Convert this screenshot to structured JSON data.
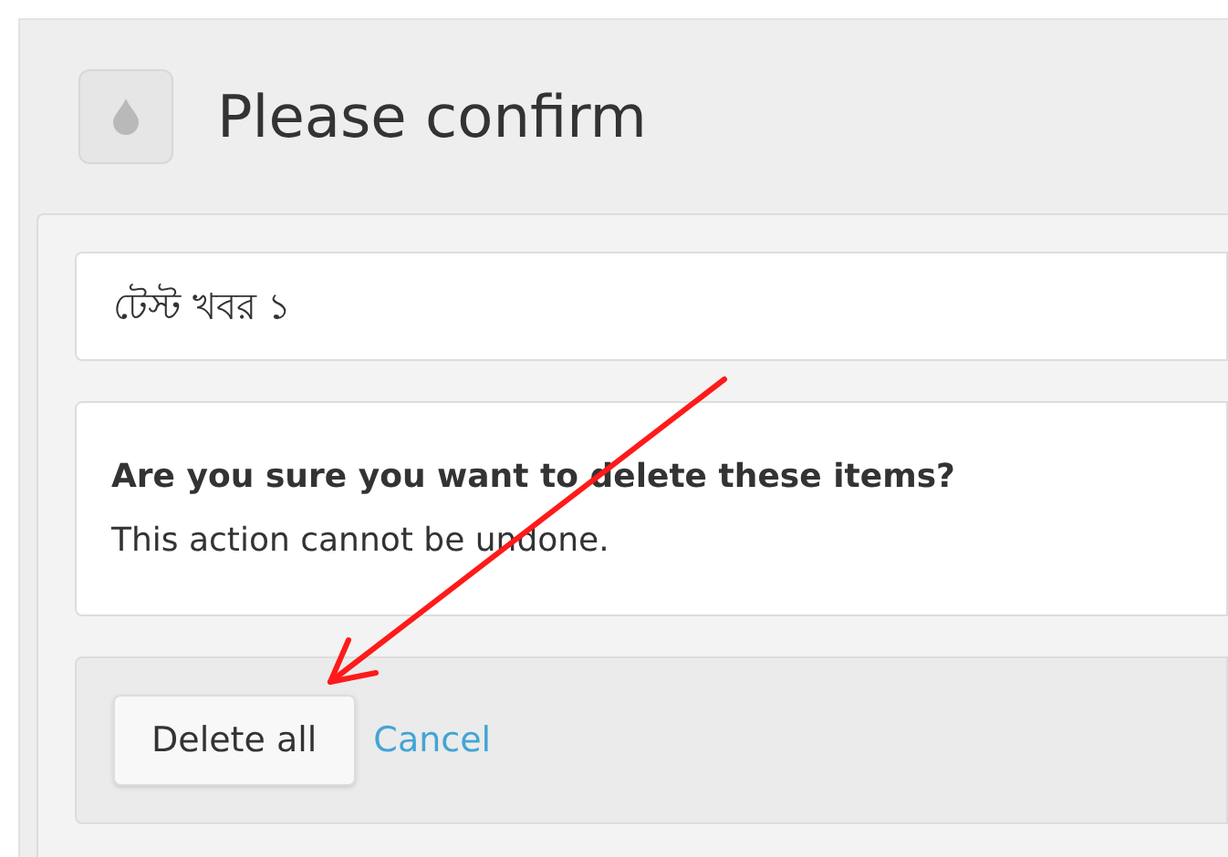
{
  "dialog": {
    "title": "Please confirm"
  },
  "items": [
    "টেস্ট খবর ১"
  ],
  "message": {
    "question": "Are you sure you want to delete these items?",
    "note": "This action cannot be undone."
  },
  "buttons": {
    "confirm": "Delete all",
    "cancel": "Cancel"
  }
}
